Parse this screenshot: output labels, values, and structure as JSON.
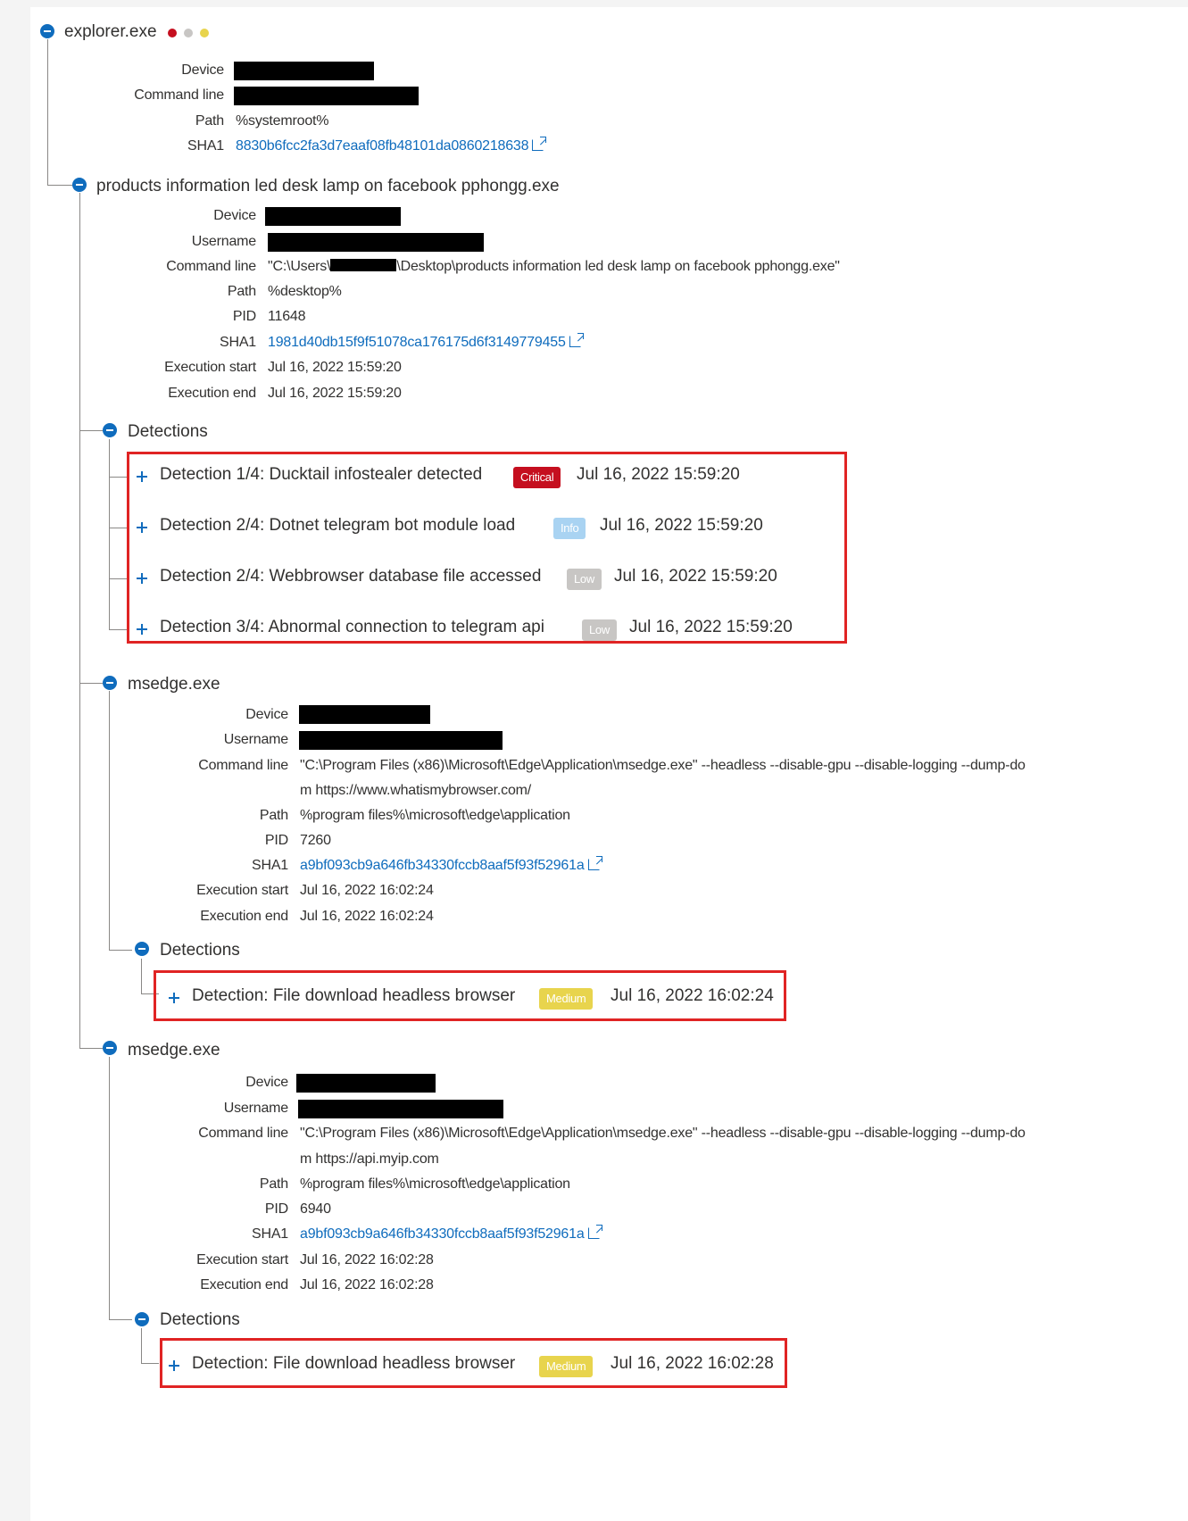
{
  "colors": {
    "accent": "#0f6cbd",
    "critical": "#c50f1f",
    "info": "#a9d3f2",
    "low": "#c8c6c4",
    "medium": "#e8d44d",
    "highlight": "#e02424"
  },
  "root": {
    "title": "explorer.exe",
    "dot_colors": [
      "#c50f1f",
      "#c8c6c4",
      "#e8d44d"
    ],
    "props": {
      "device_label": "Device",
      "cmd_label": "Command line",
      "path_label": "Path",
      "path_value": "%systemroot%",
      "sha1_label": "SHA1",
      "sha1_value": "8830b6fcc2fa3d7eaaf08fb48101da0860218638"
    }
  },
  "proc1": {
    "title": "products information led desk lamp on facebook pphongg.exe",
    "props": {
      "device_label": "Device",
      "username_label": "Username",
      "cmd_label": "Command line",
      "cmd_prefix": "\"C:\\Users\\",
      "cmd_suffix": "\\Desktop\\products information led desk lamp on facebook pphongg.exe\"",
      "path_label": "Path",
      "path_value": "%desktop%",
      "pid_label": "PID",
      "pid_value": "11648",
      "sha1_label": "SHA1",
      "sha1_value": "1981d40db15f9f51078ca176175d6f3149779455",
      "start_label": "Execution start",
      "start_value": "Jul 16, 2022 15:59:20",
      "end_label": "Execution end",
      "end_value": "Jul 16, 2022 15:59:20"
    },
    "detections_label": "Detections",
    "detections": [
      {
        "title": "Detection 1/4: Ducktail infostealer detected",
        "severity": "Critical",
        "time": "Jul 16, 2022 15:59:20"
      },
      {
        "title": "Detection 2/4: Dotnet telegram bot module load",
        "severity": "Info",
        "time": "Jul 16, 2022 15:59:20"
      },
      {
        "title": "Detection 2/4: Webbrowser database file accessed",
        "severity": "Low",
        "time": "Jul 16, 2022 15:59:20"
      },
      {
        "title": "Detection 3/4: Abnormal connection to telegram api",
        "severity": "Low",
        "time": "Jul 16, 2022 15:59:20"
      }
    ]
  },
  "proc2": {
    "title": "msedge.exe",
    "props": {
      "device_label": "Device",
      "username_label": "Username",
      "cmd_label": "Command line",
      "cmd_line1": "\"C:\\Program Files (x86)\\Microsoft\\Edge\\Application\\msedge.exe\" --headless --disable-gpu --disable-logging --dump-do",
      "cmd_line2": "m https://www.whatismybrowser.com/",
      "path_label": "Path",
      "path_value": "%program files%\\microsoft\\edge\\application",
      "pid_label": "PID",
      "pid_value": "7260",
      "sha1_label": "SHA1",
      "sha1_value": "a9bf093cb9a646fb34330fccb8aaf5f93f52961a",
      "start_label": "Execution start",
      "start_value": "Jul 16, 2022 16:02:24",
      "end_label": "Execution end",
      "end_value": "Jul 16, 2022 16:02:24"
    },
    "detections_label": "Detections",
    "detection": {
      "title": "Detection: File download headless browser",
      "severity": "Medium",
      "time": "Jul 16, 2022 16:02:24"
    }
  },
  "proc3": {
    "title": "msedge.exe",
    "props": {
      "device_label": "Device",
      "username_label": "Username",
      "cmd_label": "Command line",
      "cmd_line1": "\"C:\\Program Files (x86)\\Microsoft\\Edge\\Application\\msedge.exe\" --headless --disable-gpu --disable-logging --dump-do",
      "cmd_line2": "m https://api.myip.com",
      "path_label": "Path",
      "path_value": "%program files%\\microsoft\\edge\\application",
      "pid_label": "PID",
      "pid_value": "6940",
      "sha1_label": "SHA1",
      "sha1_value": "a9bf093cb9a646fb34330fccb8aaf5f93f52961a",
      "start_label": "Execution start",
      "start_value": "Jul 16, 2022 16:02:28",
      "end_label": "Execution end",
      "end_value": "Jul 16, 2022 16:02:28"
    },
    "detections_label": "Detections",
    "detection": {
      "title": "Detection: File download headless browser",
      "severity": "Medium",
      "time": "Jul 16, 2022 16:02:28"
    }
  }
}
